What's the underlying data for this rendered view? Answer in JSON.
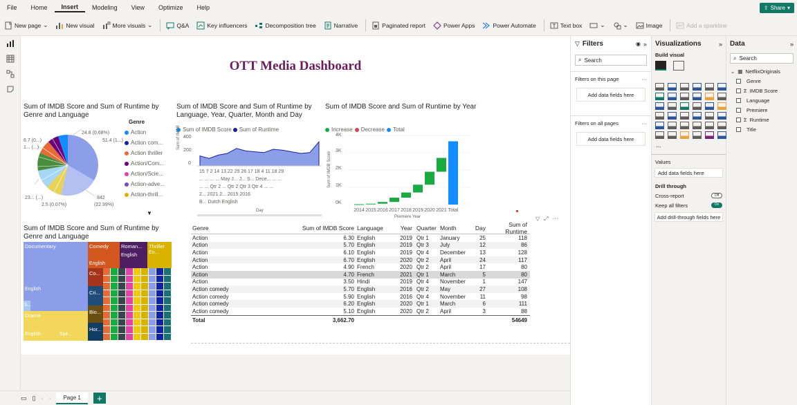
{
  "menu": [
    "File",
    "Home",
    "Insert",
    "Modeling",
    "View",
    "Optimize",
    "Help"
  ],
  "share_label": "Share",
  "ribbon": {
    "new_page": "New page",
    "new_visual": "New visual",
    "more_visuals": "More visuals",
    "qa": "Q&A",
    "key_influencers": "Key influencers",
    "decomposition_tree": "Decomposition tree",
    "narrative": "Narrative",
    "paginated_report": "Paginated report",
    "power_apps": "Power Apps",
    "power_automate": "Power Automate",
    "text_box": "Text box",
    "image": "Image",
    "add_sparkline": "Add a sparkline"
  },
  "dashboard": {
    "title": "OTT Media Dashboard"
  },
  "pie": {
    "title": "Sum of IMDB Score and Sum of Runtime by Genre and Language",
    "labels": [
      "6.7 (0...)",
      "1... (...)",
      "24.8 (0.68%)",
      "51.4 (1...)",
      "23... (...)",
      "2.5 (0.07%)",
      "842",
      "(22.99%)"
    ],
    "legend_title": "Genre",
    "legend": [
      {
        "label": "Action",
        "color": "#118dff"
      },
      {
        "label": "Action com...",
        "color": "#12239e"
      },
      {
        "label": "Action thriller",
        "color": "#e66c37"
      },
      {
        "label": "Action/Com...",
        "color": "#6b007b"
      },
      {
        "label": "Action/Scie...",
        "color": "#e044a7"
      },
      {
        "label": "Action-adve...",
        "color": "#744ec2"
      },
      {
        "label": "Action-thrill...",
        "color": "#d9b300"
      }
    ]
  },
  "area": {
    "title": "Sum of IMDB Score and Sum of Runtime by Language, Year, Quarter, Month and Day",
    "legend": [
      {
        "label": "Sum of IMDB Score",
        "color": "#118dff"
      },
      {
        "label": "Sum of Runtime",
        "color": "#12239e"
      }
    ],
    "y_ticks": [
      "400",
      "200",
      "0"
    ],
    "y_label": "Sum of IMDB",
    "day_row": "15  7  2  14 13  22 29  26 17  18  4  11 18 29",
    "month_row": "...   ...   ...   ...   May   J...   J...   S...  Dece...   ...   ...",
    "quarter_row": "...   ...   Qtr 2   ...   Qtr 2   Qtr 3   Qtr 4   ...   ...",
    "year_row": "2...  2021  2...     2015                2016",
    "lang_row": "B...   Dutch                English",
    "x_label": "Day"
  },
  "waterfall": {
    "title": "Sum of IMDB Score and Sum of Runtime by Year",
    "legend": [
      {
        "label": "Increase",
        "color": "#1aab40"
      },
      {
        "label": "Decrease",
        "color": "#d64554"
      },
      {
        "label": "Total",
        "color": "#118dff"
      }
    ],
    "y_ticks": [
      "4K",
      "3K",
      "2K",
      "1K",
      "0K"
    ],
    "y_label": "Sum of IMDB Score",
    "x_label": "Premiere Year"
  },
  "chart_data": [
    {
      "type": "bar",
      "title": "Sum of IMDB Score and Sum of Runtime by Year",
      "categories": [
        "2014",
        "2015",
        "2016",
        "2017",
        "2018",
        "2019",
        "2020",
        "2021",
        "Total"
      ],
      "values": [
        20,
        50,
        150,
        400,
        700,
        1150,
        1900,
        2700,
        3663
      ],
      "ylim": [
        0,
        4000
      ],
      "xlabel": "Premiere Year",
      "ylabel": "Sum of IMDB Score"
    },
    {
      "type": "area",
      "title": "Sum of IMDB Score and Sum of Runtime by Language, Year, Quarter, Month and Day",
      "series": [
        {
          "name": "Sum of IMDB Score",
          "values": [
            5,
            6,
            6,
            5,
            7,
            6,
            5,
            6,
            7,
            6,
            5,
            6,
            6,
            7
          ]
        },
        {
          "name": "Sum of Runtime",
          "values": [
            120,
            90,
            130,
            150,
            210,
            180,
            170,
            160,
            200,
            190,
            170,
            150,
            160,
            290
          ]
        }
      ],
      "ylim": [
        0,
        400
      ],
      "xlabel": "Day",
      "ylabel": "Sum of IMDB"
    }
  ],
  "treemap": {
    "title": "Sum of IMDB Score and Sum of Runtime by Genre and Language",
    "labels": [
      "Documentary",
      "Comedy",
      "Roman...",
      "Thriller",
      "English",
      "En...",
      "English",
      "Co...",
      "English",
      "Cri...",
      "Drama",
      "Bio...",
      "Hor...",
      "S...",
      "English",
      "Spa..."
    ]
  },
  "table": {
    "headers": [
      "Genre",
      "Sum of IMDB Score",
      "Language",
      "Year",
      "Quarter",
      "Month",
      "Day",
      "Sum of Runtime"
    ],
    "rows": [
      [
        "Action",
        "6.30",
        "English",
        "2019",
        "Qtr 1",
        "January",
        "25",
        "118"
      ],
      [
        "Action",
        "5.70",
        "English",
        "2019",
        "Qtr 3",
        "July",
        "12",
        "86"
      ],
      [
        "Action",
        "6.10",
        "English",
        "2019",
        "Qtr 4",
        "December",
        "13",
        "128"
      ],
      [
        "Action",
        "6.70",
        "English",
        "2020",
        "Qtr 2",
        "April",
        "24",
        "117"
      ],
      [
        "Action",
        "4.90",
        "French",
        "2020",
        "Qtr 2",
        "April",
        "17",
        "80"
      ],
      [
        "Action",
        "4.70",
        "French",
        "2021",
        "Qtr 1",
        "March",
        "5",
        "80"
      ],
      [
        "Action",
        "3.50",
        "Hindi",
        "2019",
        "Qtr 4",
        "November",
        "1",
        "147"
      ],
      [
        "Action comedy",
        "5.70",
        "English",
        "2016",
        "Qtr 2",
        "May",
        "27",
        "108"
      ],
      [
        "Action comedy",
        "5.90",
        "English",
        "2016",
        "Qtr 4",
        "November",
        "11",
        "98"
      ],
      [
        "Action comedy",
        "6.20",
        "English",
        "2020",
        "Qtr 1",
        "March",
        "6",
        "111"
      ],
      [
        "Action comedy",
        "5.10",
        "English",
        "2020",
        "Qtr 2",
        "April",
        "3",
        "88"
      ]
    ],
    "total": [
      "Total",
      "3,662.70",
      "",
      "",
      "",
      "",
      "",
      "54649"
    ]
  },
  "filters": {
    "title": "Filters",
    "search": "Search",
    "on_page": "Filters on this page",
    "on_all": "Filters on all pages",
    "add": "Add data fields here"
  },
  "visualizations": {
    "title": "Visualizations",
    "build_visual": "Build visual",
    "values": "Values",
    "add_data": "Add data fields here",
    "drill_through": "Drill through",
    "cross_report": "Cross-report",
    "cross_report_state": "Off",
    "keep_filters": "Keep all filters",
    "keep_filters_state": "On",
    "add_drill": "Add drill-through fields here",
    "more": "..."
  },
  "data_pane": {
    "title": "Data",
    "search": "Search",
    "table": "NetflixOriginals",
    "fields": [
      "Genre",
      "IMDB Score",
      "Language",
      "Premiere",
      "Runtime",
      "Title"
    ]
  },
  "pages": {
    "tab": "Page 1",
    "add": "+"
  }
}
